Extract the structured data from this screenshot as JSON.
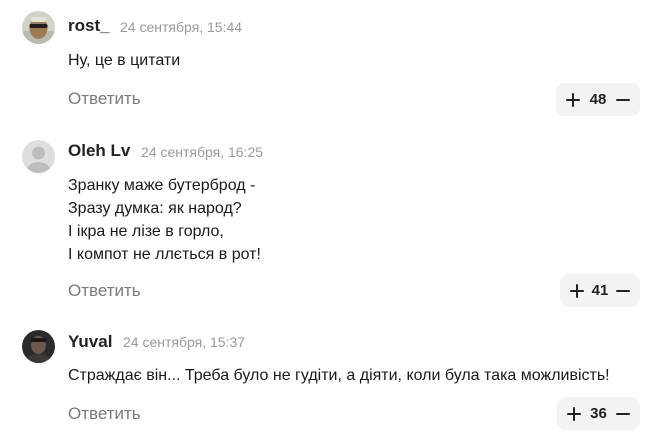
{
  "comments": [
    {
      "author": "rost_",
      "date": "24 сентября, 15:44",
      "lines": [
        "Ну, це в цитати"
      ],
      "reply_label": "Ответить",
      "votes": "48",
      "avatar_icon": "user-photo-avatar"
    },
    {
      "author": "Oleh Lv",
      "date": "24 сентября, 16:25",
      "lines": [
        "Зранку маже бутерброд -",
        "Зразу думка: як народ?",
        "І ікра не лізе в горло,",
        "І компот не ллється в рот!"
      ],
      "reply_label": "Ответить",
      "votes": "41",
      "avatar_icon": "default-user-avatar"
    },
    {
      "author": "Yuval",
      "date": "24 сентября, 15:37",
      "lines": [
        "Страждає він... Треба було не гудіти, а діяти, коли була така можливість!"
      ],
      "reply_label": "Ответить",
      "votes": "36",
      "avatar_icon": "user-photo-avatar"
    }
  ],
  "colors": {
    "vote_bg": "#f2f3f5",
    "date": "#9a9a9a",
    "reply": "#7a7a7a"
  }
}
